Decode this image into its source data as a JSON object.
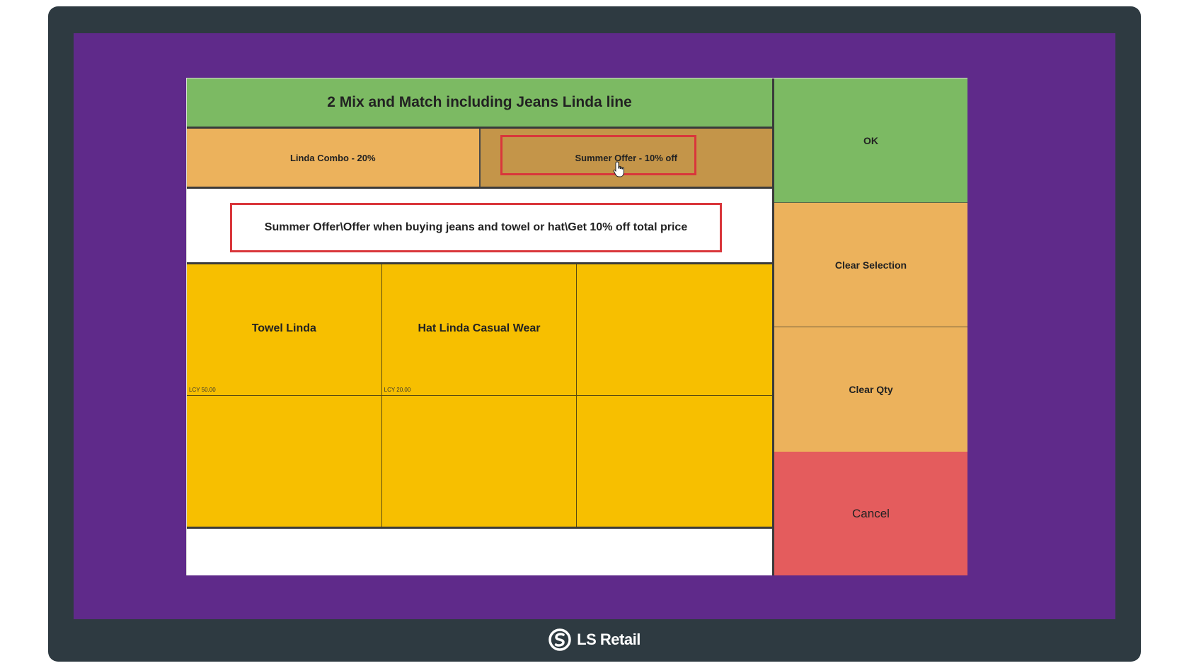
{
  "dialog": {
    "title": "2 Mix and Match including Jeans Linda line",
    "offers": [
      {
        "label": "Linda Combo - 20%"
      },
      {
        "label": "Summer Offer - 10% off"
      }
    ],
    "description": "Summer Offer\\Offer when buying jeans and towel or hat\\Get 10% off total price",
    "items": [
      {
        "name": "Towel Linda",
        "price": "LCY 50.00"
      },
      {
        "name": "Hat Linda Casual Wear",
        "price": "LCY 20.00"
      },
      {
        "name": "",
        "price": ""
      },
      {
        "name": "",
        "price": ""
      },
      {
        "name": "",
        "price": ""
      },
      {
        "name": "",
        "price": ""
      }
    ]
  },
  "actions": {
    "ok": "OK",
    "clear_selection": "Clear Selection",
    "clear_qty": "Clear Qty",
    "cancel": "Cancel"
  },
  "brand": {
    "name": "LS Retail"
  },
  "colors": {
    "screen_bg": "#5f2a8a",
    "header_green": "#7cba63",
    "offer_orange": "#ecb25c",
    "offer_selected": "#c49549",
    "item_yellow": "#f7bf00",
    "cancel_red": "#e45c5d",
    "highlight_red": "#d9363b"
  }
}
